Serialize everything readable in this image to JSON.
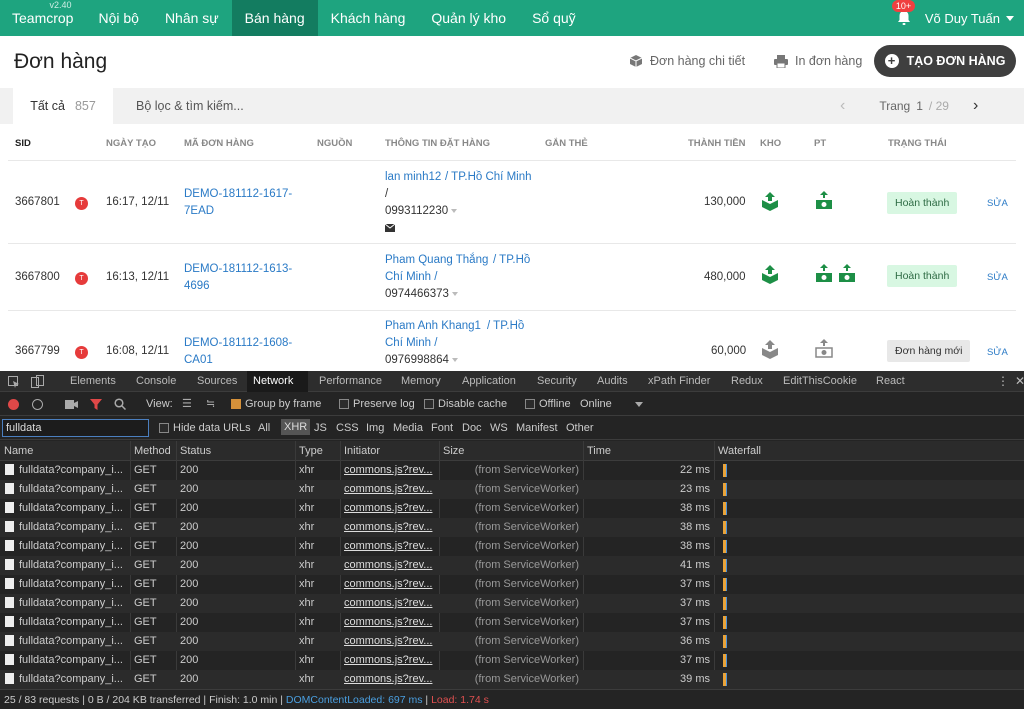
{
  "nav": {
    "brand": "Teamcrop",
    "version": "v2.40",
    "items": [
      "Nội bộ",
      "Nhân sự",
      "Bán hàng",
      "Khách hàng",
      "Quản lý kho",
      "Sổ quỹ"
    ],
    "active": "Bán hàng",
    "notifications": "10+",
    "user": "Võ Duy Tuấn"
  },
  "header": {
    "title": "Đơn hàng",
    "detail_label": "Đơn hàng chi tiết",
    "print_label": "In đơn hàng",
    "create_label": "TẠO ĐƠN HÀNG"
  },
  "tabs": {
    "all_label": "Tất cả",
    "all_count": "857",
    "filter_label": "Bộ lọc & tìm kiếm...",
    "page_label": "Trang",
    "page_current": "1",
    "page_total": "/ 29"
  },
  "table": {
    "headers": [
      "SID",
      "NGÀY TẠO",
      "MÃ ĐƠN HÀNG",
      "NGUỒN",
      "THÔNG TIN ĐẶT HÀNG",
      "GẮN THẺ",
      "THÀNH TIỀN",
      "KHO",
      "PT",
      "TRẠNG THÁI"
    ],
    "rows": [
      {
        "sid": "3667801",
        "tag": "T",
        "date": "16:17, 12/11",
        "code1": "DEMO-181112-1617-",
        "code2": "7EAD",
        "name": "lan minh12",
        "city": "/ TP.Hồ Chí Minh",
        "line3": "/",
        "phone": "0993112230",
        "amount": "130,000",
        "status": "Hoàn thành",
        "edit": "SỬA"
      },
      {
        "sid": "3667800",
        "tag": "T",
        "date": "16:13, 12/11",
        "code1": "DEMO-181112-1613-",
        "code2": "4696",
        "name": "Pham Quang Thắng",
        "city": "/ TP.Hồ",
        "line3": "Chí Minh /",
        "phone": "0974466373",
        "amount": "480,000",
        "status": "Hoàn thành",
        "edit": "SỬA"
      },
      {
        "sid": "3667799",
        "tag": "T",
        "date": "16:08, 12/11",
        "code1": "DEMO-181112-1608-",
        "code2": "CA01",
        "name": "Pham Anh Khang1",
        "city": "/ TP.Hồ",
        "line3": "Chí Minh /",
        "phone": "0976998864",
        "amount": "60,000",
        "status": "Đơn hàng mới",
        "edit": "SỬA"
      }
    ]
  },
  "devtools": {
    "tabs": [
      "Elements",
      "Console",
      "Sources",
      "Network",
      "Performance",
      "Memory",
      "Application",
      "Security",
      "Audits",
      "xPath Finder",
      "Redux",
      "EditThisCookie",
      "React"
    ],
    "active_tab": "Network",
    "toolbar": {
      "view": "View:",
      "group": "Group by frame",
      "preserve": "Preserve log",
      "cache": "Disable cache",
      "offline": "Offline",
      "online": "Online"
    },
    "filter": {
      "value": "fulldata",
      "hide": "Hide data URLs",
      "types": [
        "All",
        "XHR",
        "JS",
        "CSS",
        "Img",
        "Media",
        "Font",
        "Doc",
        "WS",
        "Manifest",
        "Other"
      ]
    },
    "columns": [
      "Name",
      "Method",
      "Status",
      "Type",
      "Initiator",
      "Size",
      "Time",
      "Waterfall"
    ],
    "requests": [
      {
        "name": "fulldata?company_i...",
        "method": "GET",
        "status": "200",
        "type": "xhr",
        "initiator": "commons.js?rev...",
        "size": "(from ServiceWorker)",
        "time": "22 ms"
      },
      {
        "name": "fulldata?company_i...",
        "method": "GET",
        "status": "200",
        "type": "xhr",
        "initiator": "commons.js?rev...",
        "size": "(from ServiceWorker)",
        "time": "23 ms"
      },
      {
        "name": "fulldata?company_i...",
        "method": "GET",
        "status": "200",
        "type": "xhr",
        "initiator": "commons.js?rev...",
        "size": "(from ServiceWorker)",
        "time": "38 ms"
      },
      {
        "name": "fulldata?company_i...",
        "method": "GET",
        "status": "200",
        "type": "xhr",
        "initiator": "commons.js?rev...",
        "size": "(from ServiceWorker)",
        "time": "38 ms"
      },
      {
        "name": "fulldata?company_i...",
        "method": "GET",
        "status": "200",
        "type": "xhr",
        "initiator": "commons.js?rev...",
        "size": "(from ServiceWorker)",
        "time": "38 ms"
      },
      {
        "name": "fulldata?company_i...",
        "method": "GET",
        "status": "200",
        "type": "xhr",
        "initiator": "commons.js?rev...",
        "size": "(from ServiceWorker)",
        "time": "41 ms"
      },
      {
        "name": "fulldata?company_i...",
        "method": "GET",
        "status": "200",
        "type": "xhr",
        "initiator": "commons.js?rev...",
        "size": "(from ServiceWorker)",
        "time": "37 ms"
      },
      {
        "name": "fulldata?company_i...",
        "method": "GET",
        "status": "200",
        "type": "xhr",
        "initiator": "commons.js?rev...",
        "size": "(from ServiceWorker)",
        "time": "37 ms"
      },
      {
        "name": "fulldata?company_i...",
        "method": "GET",
        "status": "200",
        "type": "xhr",
        "initiator": "commons.js?rev...",
        "size": "(from ServiceWorker)",
        "time": "37 ms"
      },
      {
        "name": "fulldata?company_i...",
        "method": "GET",
        "status": "200",
        "type": "xhr",
        "initiator": "commons.js?rev...",
        "size": "(from ServiceWorker)",
        "time": "36 ms"
      },
      {
        "name": "fulldata?company_i...",
        "method": "GET",
        "status": "200",
        "type": "xhr",
        "initiator": "commons.js?rev...",
        "size": "(from ServiceWorker)",
        "time": "37 ms"
      },
      {
        "name": "fulldata?company_i...",
        "method": "GET",
        "status": "200",
        "type": "xhr",
        "initiator": "commons.js?rev...",
        "size": "(from ServiceWorker)",
        "time": "39 ms"
      }
    ],
    "status_bar": {
      "summary": "25 / 83 requests | 0 B / 204 KB transferred | Finish: 1.0 min |",
      "dcl": "DOMContentLoaded: 697 ms",
      "sep": "|",
      "load": "Load: 1.74 s"
    }
  },
  "colors": {
    "brand": "#1ea47f",
    "nav_active": "#137c60",
    "link": "#2a7ac6",
    "done_bg": "#d8f7e2",
    "dcl": "#4a9fe0",
    "load": "#e05050"
  }
}
